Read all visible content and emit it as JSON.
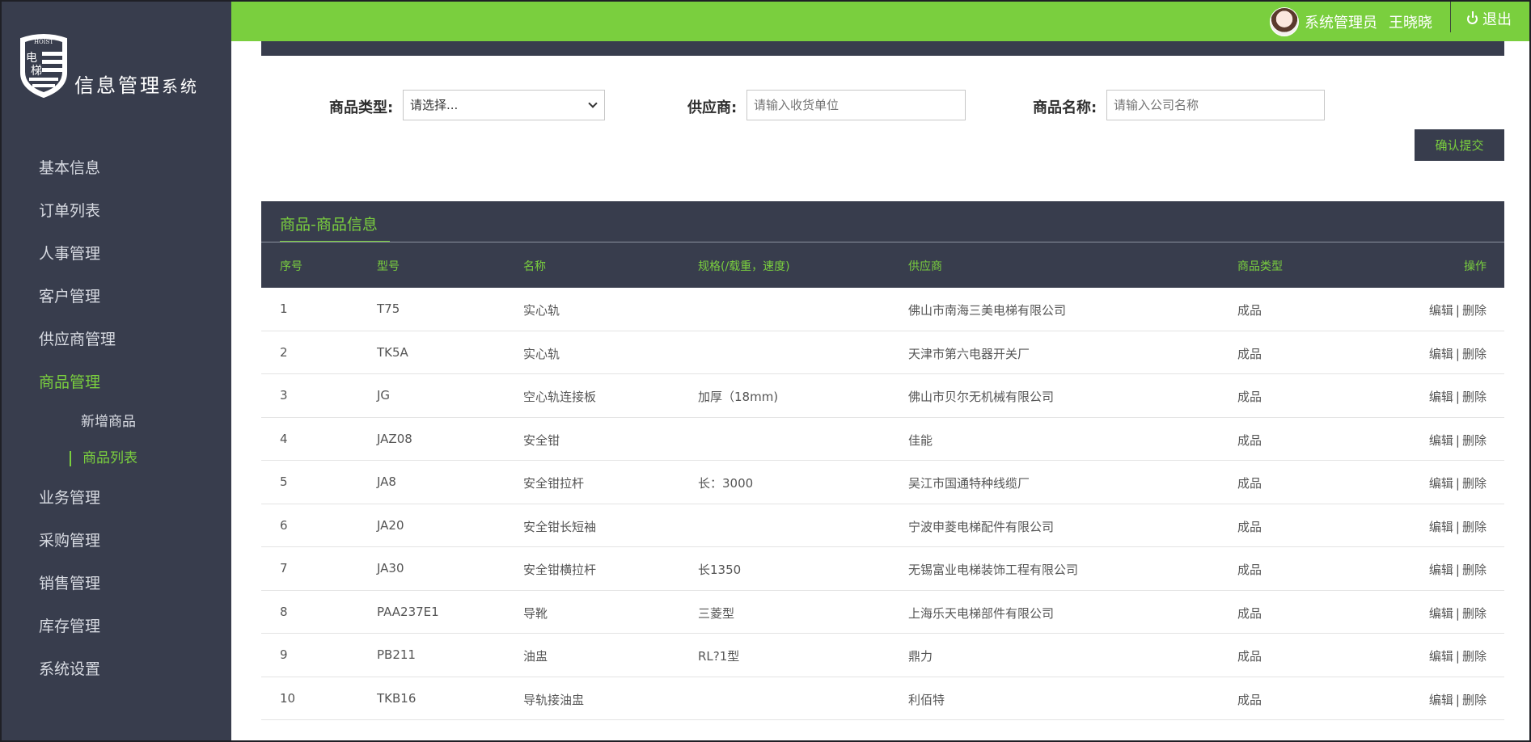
{
  "app": {
    "logo_badge": "电梯",
    "logo_badge_top": "HOIST",
    "logo_text": "信息管理",
    "logo_text_suffix": "系统"
  },
  "header": {
    "role": "系统管理员",
    "username": "王晓晓",
    "logout_label": "退出"
  },
  "sidebar": {
    "items": [
      {
        "label": "基本信息"
      },
      {
        "label": "订单列表"
      },
      {
        "label": "人事管理"
      },
      {
        "label": "客户管理"
      },
      {
        "label": "供应商管理"
      },
      {
        "label": "商品管理",
        "active": true
      },
      {
        "label": "新增商品",
        "sub": true
      },
      {
        "label": "商品列表",
        "sub": true,
        "active": true
      },
      {
        "label": "业务管理"
      },
      {
        "label": "采购管理"
      },
      {
        "label": "销售管理"
      },
      {
        "label": "库存管理"
      },
      {
        "label": "系统设置"
      }
    ]
  },
  "filters": {
    "type_label": "商品类型:",
    "type_value": "请选择...",
    "supplier_label": "供应商:",
    "supplier_placeholder": "请输入收货单位",
    "name_label": "商品名称:",
    "name_placeholder": "请输入公司名称",
    "submit_label": "确认提交"
  },
  "table": {
    "title": "商品-商品信息",
    "columns": [
      "序号",
      "型号",
      "名称",
      "规格(/载重，速度)",
      "供应商",
      "商品类型",
      "操作"
    ],
    "edit_label": "编辑",
    "delete_label": "删除",
    "separator": "|",
    "rows": [
      {
        "no": "1",
        "model": "T75",
        "name": "实心轨",
        "spec": "",
        "supplier": "佛山市南海三美电梯有限公司",
        "type": "成品"
      },
      {
        "no": "2",
        "model": "TK5A",
        "name": "实心轨",
        "spec": "",
        "supplier": "天津市第六电器开关厂",
        "type": "成品"
      },
      {
        "no": "3",
        "model": "JG",
        "name": "空心轨连接板",
        "spec": "加厚（18mm)",
        "supplier": "佛山市贝尔无机械有限公司",
        "type": "成品"
      },
      {
        "no": "4",
        "model": "JAZ08",
        "name": "安全钳",
        "spec": "",
        "supplier": "佳能",
        "type": "成品"
      },
      {
        "no": "5",
        "model": "JA8",
        "name": "安全钳拉杆",
        "spec": "长：3000",
        "supplier": "吴江市国通特种线缆厂",
        "type": "成品"
      },
      {
        "no": "6",
        "model": "JA20",
        "name": "安全钳长短袖",
        "spec": "",
        "supplier": "宁波申菱电梯配件有限公司",
        "type": "成品"
      },
      {
        "no": "7",
        "model": "JA30",
        "name": "安全钳横拉杆",
        "spec": "长1350",
        "supplier": "无锡富业电梯装饰工程有限公司",
        "type": "成品"
      },
      {
        "no": "8",
        "model": "PAA237E1",
        "name": "导靴",
        "spec": "三菱型",
        "supplier": "上海乐天电梯部件有限公司",
        "type": "成品"
      },
      {
        "no": "9",
        "model": "PB211",
        "name": "油盅",
        "spec": "RL?1型",
        "supplier": "鼎力",
        "type": "成品"
      },
      {
        "no": "10",
        "model": "TKB16",
        "name": "导轨接油盅",
        "spec": "",
        "supplier": "利佰特",
        "type": "成品"
      }
    ]
  },
  "colors": {
    "accent": "#7acf3e",
    "sidebar_bg": "#383d4d",
    "page_bg": "#ffffff"
  },
  "icons": {
    "logo": "elevator-shield-icon",
    "avatar": "user-avatar",
    "logout": "power-icon",
    "select": "chevron-down-icon"
  }
}
